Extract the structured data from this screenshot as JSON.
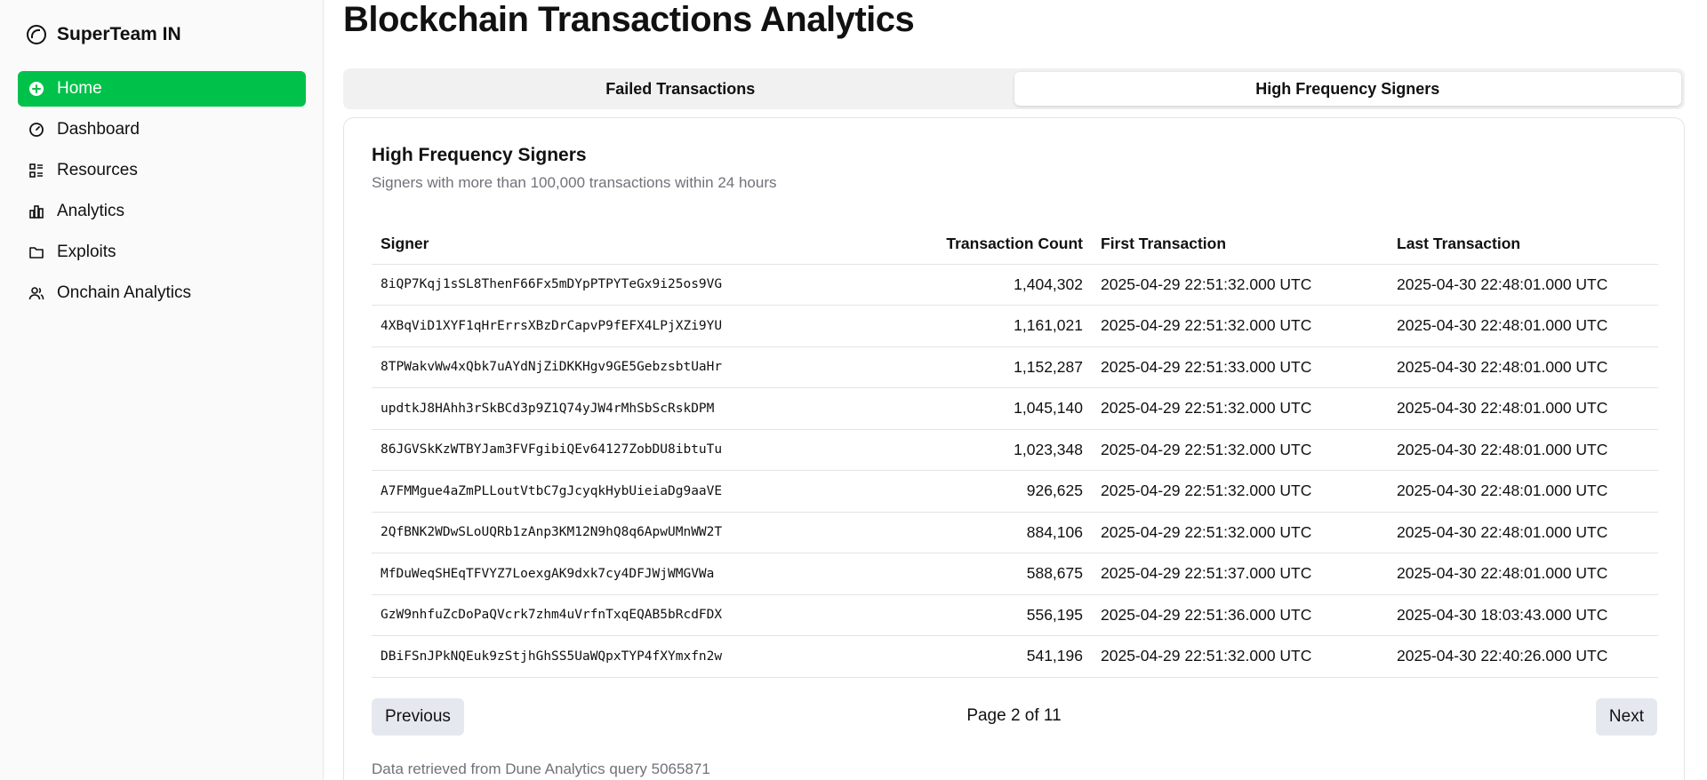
{
  "sidebar": {
    "brand": "SuperTeam IN",
    "items": [
      {
        "label": "Home",
        "icon": "plus-circle-icon",
        "active": true
      },
      {
        "label": "Dashboard",
        "icon": "gauge-icon"
      },
      {
        "label": "Resources",
        "icon": "list-icon"
      },
      {
        "label": "Analytics",
        "icon": "bar-chart-icon"
      },
      {
        "label": "Exploits",
        "icon": "folder-icon"
      },
      {
        "label": "Onchain Analytics",
        "icon": "users-icon"
      }
    ],
    "accent": "#00c24a"
  },
  "page": {
    "title": "Blockchain Transactions Analytics"
  },
  "tabs": [
    {
      "label": "Failed Transactions",
      "active": false
    },
    {
      "label": "High Frequency Signers",
      "active": true
    }
  ],
  "card": {
    "title": "High Frequency Signers",
    "description": "Signers with more than 100,000 transactions within 24 hours"
  },
  "table": {
    "headers": {
      "signer": "Signer",
      "count": "Transaction Count",
      "first": "First Transaction",
      "last": "Last Transaction"
    },
    "rows": [
      {
        "signer": "8iQP7Kqj1sSL8ThenF66Fx5mDYpPTPYTeGx9i25os9VG",
        "count": "1,404,302",
        "first": "2025-04-29 22:51:32.000 UTC",
        "last": "2025-04-30 22:48:01.000 UTC"
      },
      {
        "signer": "4XBqViD1XYF1qHrErrsXBzDrCapvP9fEFX4LPjXZi9YU",
        "count": "1,161,021",
        "first": "2025-04-29 22:51:32.000 UTC",
        "last": "2025-04-30 22:48:01.000 UTC"
      },
      {
        "signer": "8TPWakvWw4xQbk7uAYdNjZiDKKHgv9GE5GebzsbtUaHr",
        "count": "1,152,287",
        "first": "2025-04-29 22:51:33.000 UTC",
        "last": "2025-04-30 22:48:01.000 UTC"
      },
      {
        "signer": "updtkJ8HAhh3rSkBCd3p9Z1Q74yJW4rMhSbScRskDPM",
        "count": "1,045,140",
        "first": "2025-04-29 22:51:32.000 UTC",
        "last": "2025-04-30 22:48:01.000 UTC"
      },
      {
        "signer": "86JGVSkKzWTBYJam3FVFgibiQEv64127ZobDU8ibtuTu",
        "count": "1,023,348",
        "first": "2025-04-29 22:51:32.000 UTC",
        "last": "2025-04-30 22:48:01.000 UTC"
      },
      {
        "signer": "A7FMMgue4aZmPLLoutVtbC7gJcyqkHybUieiaDg9aaVE",
        "count": "926,625",
        "first": "2025-04-29 22:51:32.000 UTC",
        "last": "2025-04-30 22:48:01.000 UTC"
      },
      {
        "signer": "2QfBNK2WDwSLoUQRb1zAnp3KM12N9hQ8q6ApwUMnWW2T",
        "count": "884,106",
        "first": "2025-04-29 22:51:32.000 UTC",
        "last": "2025-04-30 22:48:01.000 UTC"
      },
      {
        "signer": "MfDuWeqSHEqTFVYZ7LoexgAK9dxk7cy4DFJWjWMGVWa",
        "count": "588,675",
        "first": "2025-04-29 22:51:37.000 UTC",
        "last": "2025-04-30 22:48:01.000 UTC"
      },
      {
        "signer": "GzW9nhfuZcDoPaQVcrk7zhm4uVrfnTxqEQAB5bRcdFDX",
        "count": "556,195",
        "first": "2025-04-29 22:51:36.000 UTC",
        "last": "2025-04-30 18:03:43.000 UTC"
      },
      {
        "signer": "DBiFSnJPkNQEuk9zStjhGhSS5UaWQpxTYP4fXYmxfn2w",
        "count": "541,196",
        "first": "2025-04-29 22:51:32.000 UTC",
        "last": "2025-04-30 22:40:26.000 UTC"
      }
    ]
  },
  "pagination": {
    "prev": "Previous",
    "next": "Next",
    "info": "Page 2 of 11"
  },
  "source": "Data retrieved from Dune Analytics query 5065871"
}
